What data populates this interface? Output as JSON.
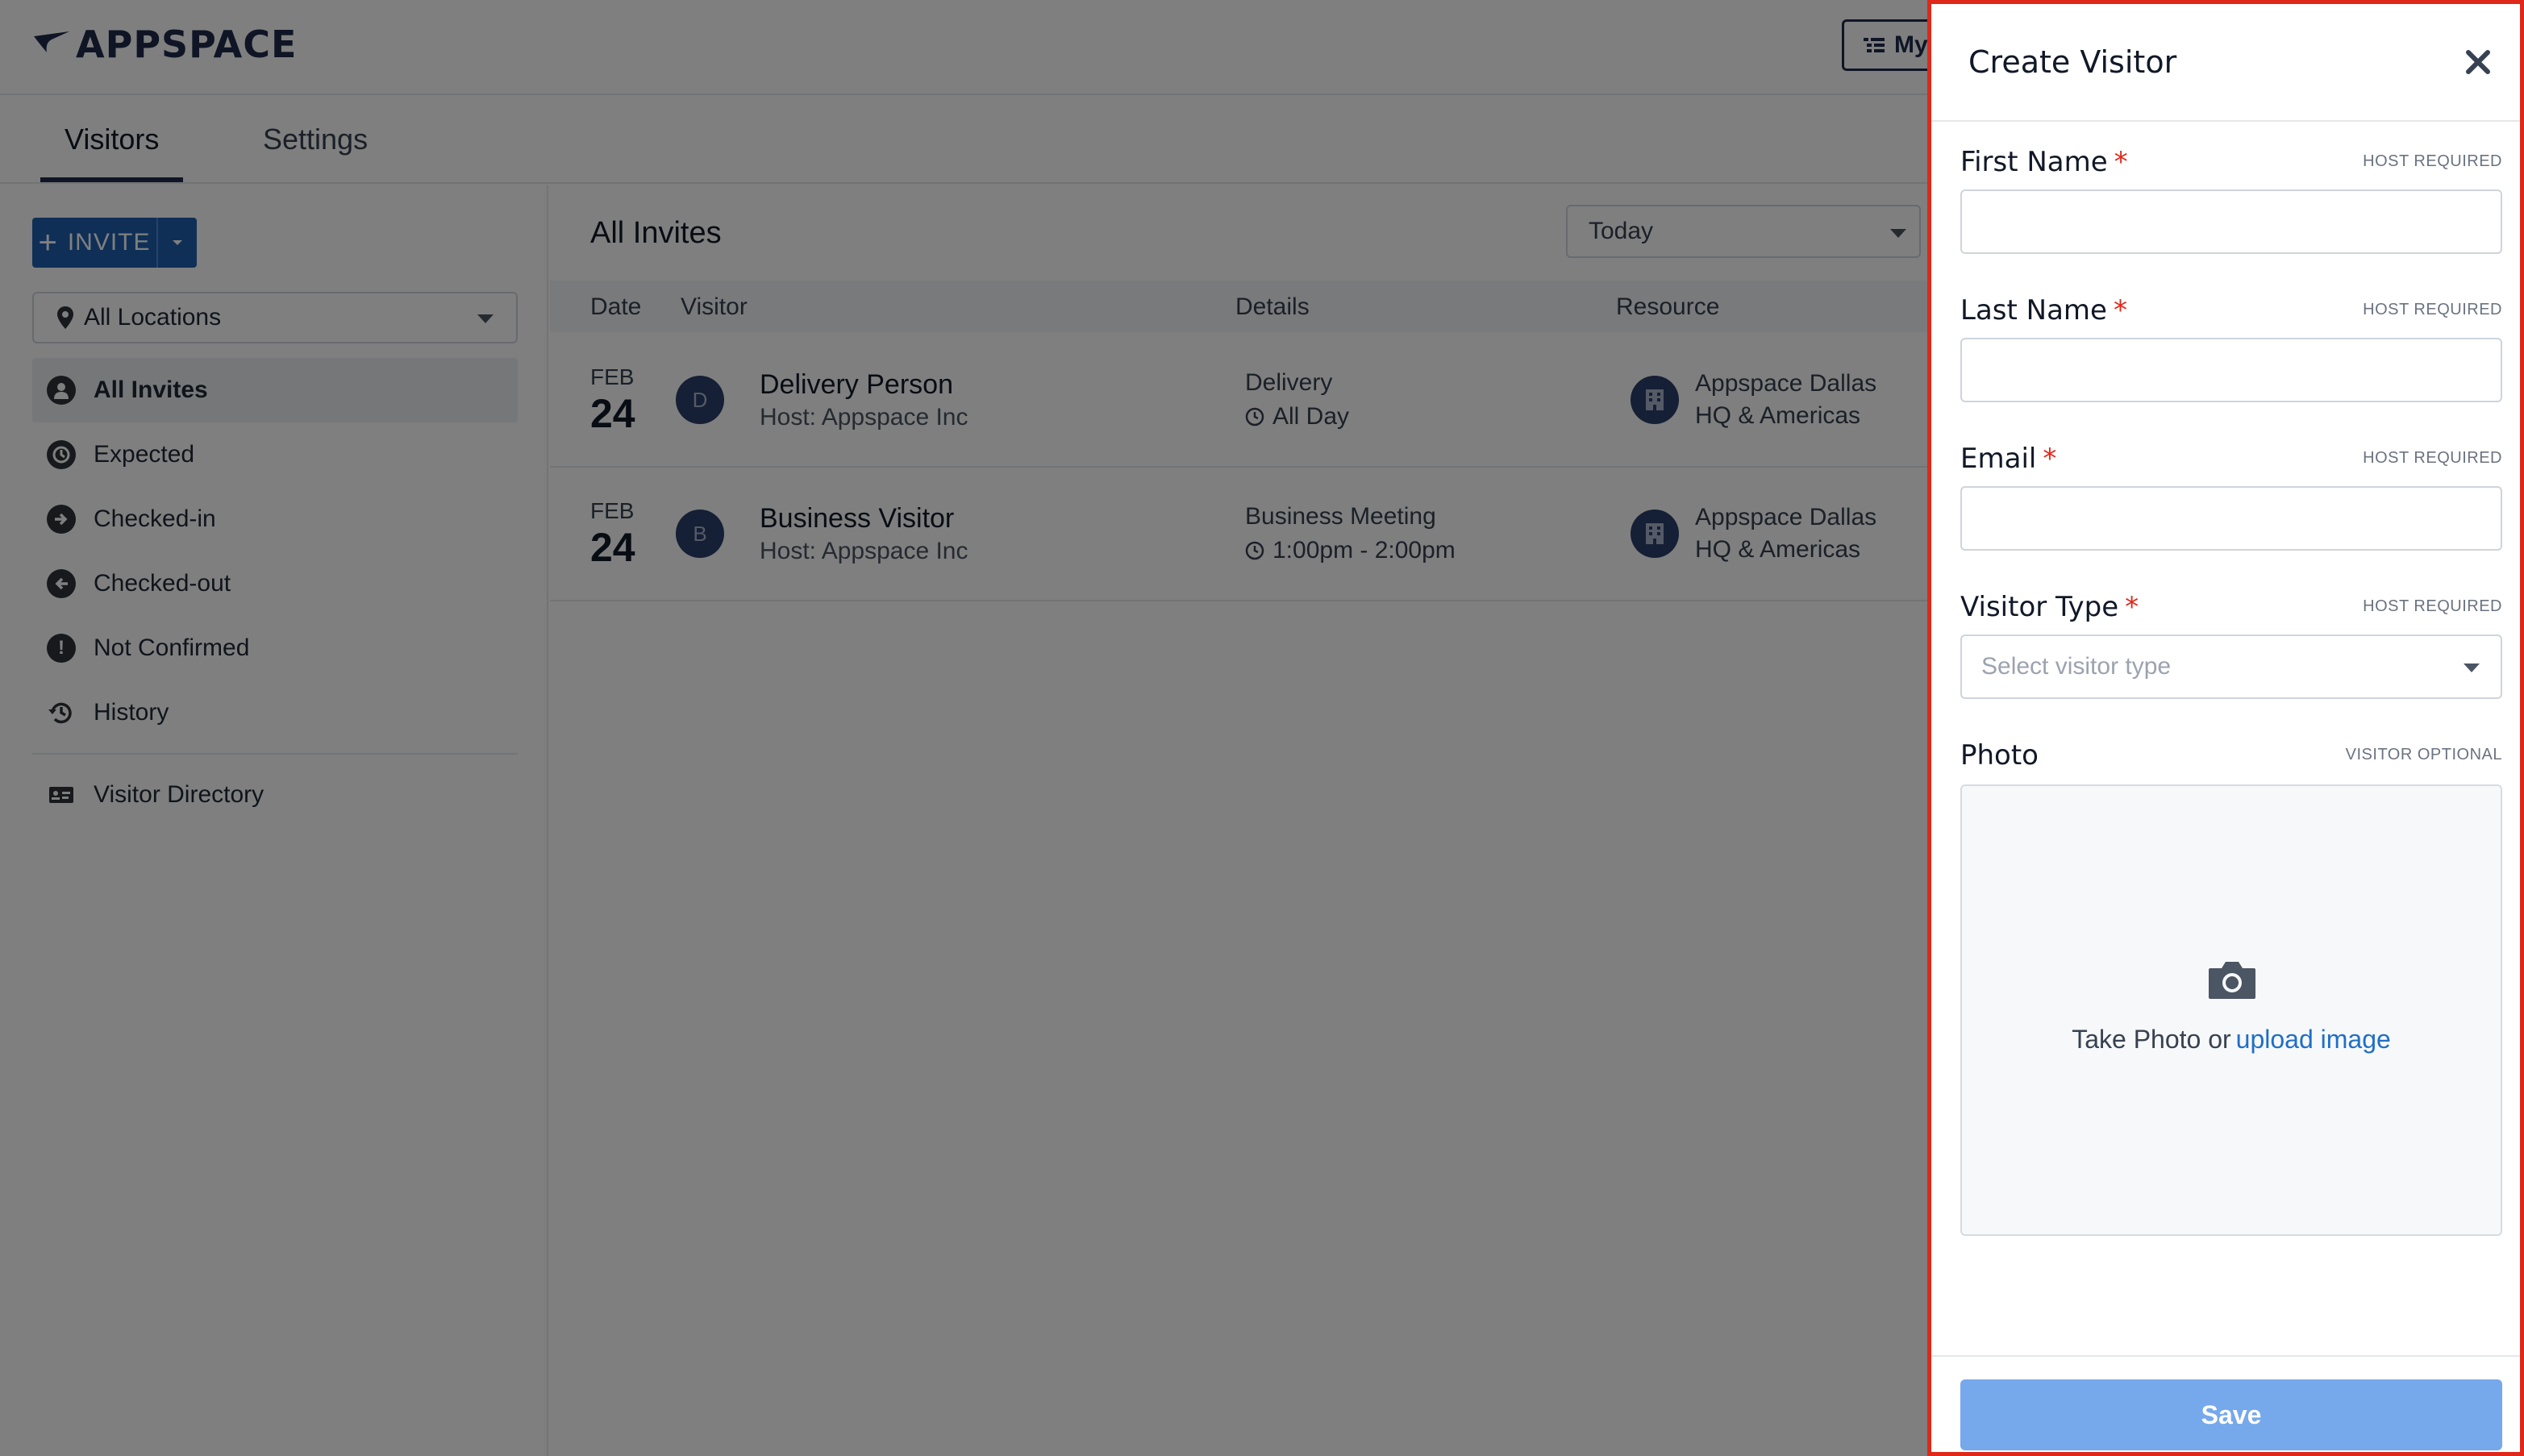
{
  "app": {
    "logo_text": "APPSPACE",
    "my_button_label": "My"
  },
  "tabs": [
    {
      "label": "Visitors"
    },
    {
      "label": "Settings"
    }
  ],
  "sidebar": {
    "invite_label": "INVITE",
    "location_filter": "All Locations",
    "items": [
      {
        "label": "All Invites",
        "icon": "person-icon"
      },
      {
        "label": "Expected",
        "icon": "clock-icon"
      },
      {
        "label": "Checked-in",
        "icon": "arrow-in-icon"
      },
      {
        "label": "Checked-out",
        "icon": "arrow-out-icon"
      },
      {
        "label": "Not Confirmed",
        "icon": "exclamation-icon"
      },
      {
        "label": "History",
        "icon": "history-icon"
      }
    ],
    "directory_label": "Visitor Directory"
  },
  "main": {
    "title": "All Invites",
    "date_filter": "Today",
    "columns": [
      "Date",
      "Visitor",
      "Details",
      "Resource"
    ],
    "rows": [
      {
        "month": "FEB",
        "day": "24",
        "initial": "D",
        "name": "Delivery Person",
        "host": "Host: Appspace Inc",
        "type": "Delivery",
        "time": "All Day",
        "resource_line1": "Appspace Dallas",
        "resource_line2": "HQ & Americas"
      },
      {
        "month": "FEB",
        "day": "24",
        "initial": "B",
        "name": "Business Visitor",
        "host": "Host: Appspace Inc",
        "type": "Business Meeting",
        "time": "1:00pm - 2:00pm",
        "resource_line1": "Appspace Dallas",
        "resource_line2": "HQ & Americas"
      }
    ]
  },
  "drawer": {
    "title": "Create Visitor",
    "fields": {
      "first_name": {
        "label": "First Name",
        "tag": "HOST REQUIRED",
        "required": "*"
      },
      "last_name": {
        "label": "Last Name",
        "tag": "HOST REQUIRED",
        "required": "*"
      },
      "email": {
        "label": "Email",
        "tag": "HOST REQUIRED",
        "required": "*"
      },
      "visitor_type": {
        "label": "Visitor Type",
        "tag": "HOST REQUIRED",
        "required": "*",
        "placeholder": "Select visitor type"
      },
      "photo": {
        "label": "Photo",
        "tag": "VISITOR OPTIONAL",
        "take_photo": "Take Photo or",
        "upload_link": "upload image"
      }
    },
    "save_label": "Save"
  },
  "colors": {
    "accent": "#1f5fae",
    "required": "#e0281a",
    "link": "#1f6fc6",
    "save_disabled": "#76a8ec",
    "highlight_border": "#e0281a"
  }
}
